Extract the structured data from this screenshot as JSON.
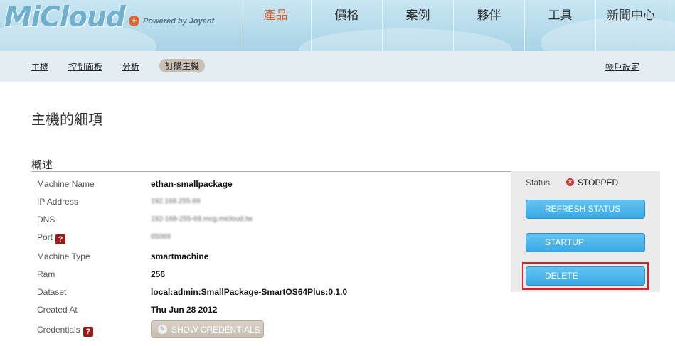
{
  "brand": {
    "logo_text": "MiCloud",
    "powered_by": "Powered by Joyent"
  },
  "main_nav": {
    "items": [
      "產品",
      "價格",
      "案例",
      "夥伴",
      "工具",
      "新聞中心"
    ],
    "active": "產品"
  },
  "sub_nav": {
    "items": [
      "主機",
      "控制面板",
      "分析",
      "訂購主機"
    ],
    "active": "訂購主機",
    "account_settings": "帳戶設定"
  },
  "page_title": "主機的細項",
  "section_title": "概述",
  "details": {
    "machine_name": {
      "label": "Machine Name",
      "value": "ethan-smallpackage"
    },
    "ip_address": {
      "label": "IP Address",
      "value": "192.168.255.69"
    },
    "dns": {
      "label": "DNS",
      "value": "192-168-255-69.mcg.micloud.tw"
    },
    "port": {
      "label": "Port",
      "value": "65069"
    },
    "machine_type": {
      "label": "Machine Type",
      "value": "smartmachine"
    },
    "ram": {
      "label": "Ram",
      "value": "256"
    },
    "dataset": {
      "label": "Dataset",
      "value": "local:admin:SmallPackage-SmartOS64Plus:0.1.0"
    },
    "created_at": {
      "label": "Created At",
      "value": "Thu Jun 28 2012"
    },
    "credentials": {
      "label": "Credentials",
      "button": "SHOW CREDENTIALS"
    }
  },
  "help_glyph": "?",
  "status_panel": {
    "label": "Status",
    "value": "STOPPED",
    "buttons": {
      "refresh": "REFRESH STATUS",
      "startup": "STARTUP",
      "delete": "DELETE"
    }
  },
  "colors": {
    "accent_orange": "#e0622d",
    "button_blue": "#3aa9e4",
    "help_red": "#9b1b1b",
    "highlight_red": "#e01e26"
  },
  "icons": [
    "plus-icon",
    "help-icon",
    "stopped-x-icon",
    "pencil-icon"
  ]
}
